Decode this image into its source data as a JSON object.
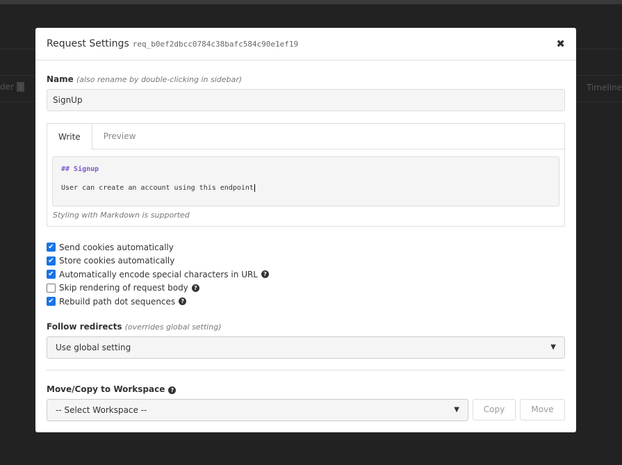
{
  "background": {
    "left_tab": "der",
    "left_badge": "1",
    "right_tab": "Timeline"
  },
  "modal": {
    "title": "Request Settings",
    "request_id": "req_b0ef2dbcc0784c38bafc584c90e1ef19",
    "name": {
      "label": "Name",
      "hint": "(also rename by double-clicking in sidebar)",
      "value": "SignUp"
    },
    "description": {
      "tabs": [
        "Write",
        "Preview"
      ],
      "heading": "## Signup",
      "paragraph": "User can create an account using this endpoint",
      "footer": "Styling with Markdown is supported"
    },
    "options": [
      {
        "label": "Send cookies automatically",
        "checked": true,
        "help": false
      },
      {
        "label": "Store cookies automatically",
        "checked": true,
        "help": false
      },
      {
        "label": "Automatically encode special characters in URL",
        "checked": true,
        "help": true
      },
      {
        "label": "Skip rendering of request body",
        "checked": false,
        "help": true
      },
      {
        "label": "Rebuild path dot sequences",
        "checked": true,
        "help": true
      }
    ],
    "redirects": {
      "label": "Follow redirects",
      "hint": "(overrides global setting)",
      "value": "Use global setting"
    },
    "move_copy": {
      "label": "Move/Copy to Workspace",
      "select": "-- Select Workspace --",
      "copy": "Copy",
      "move": "Move"
    }
  },
  "accent": "#1a73e8"
}
